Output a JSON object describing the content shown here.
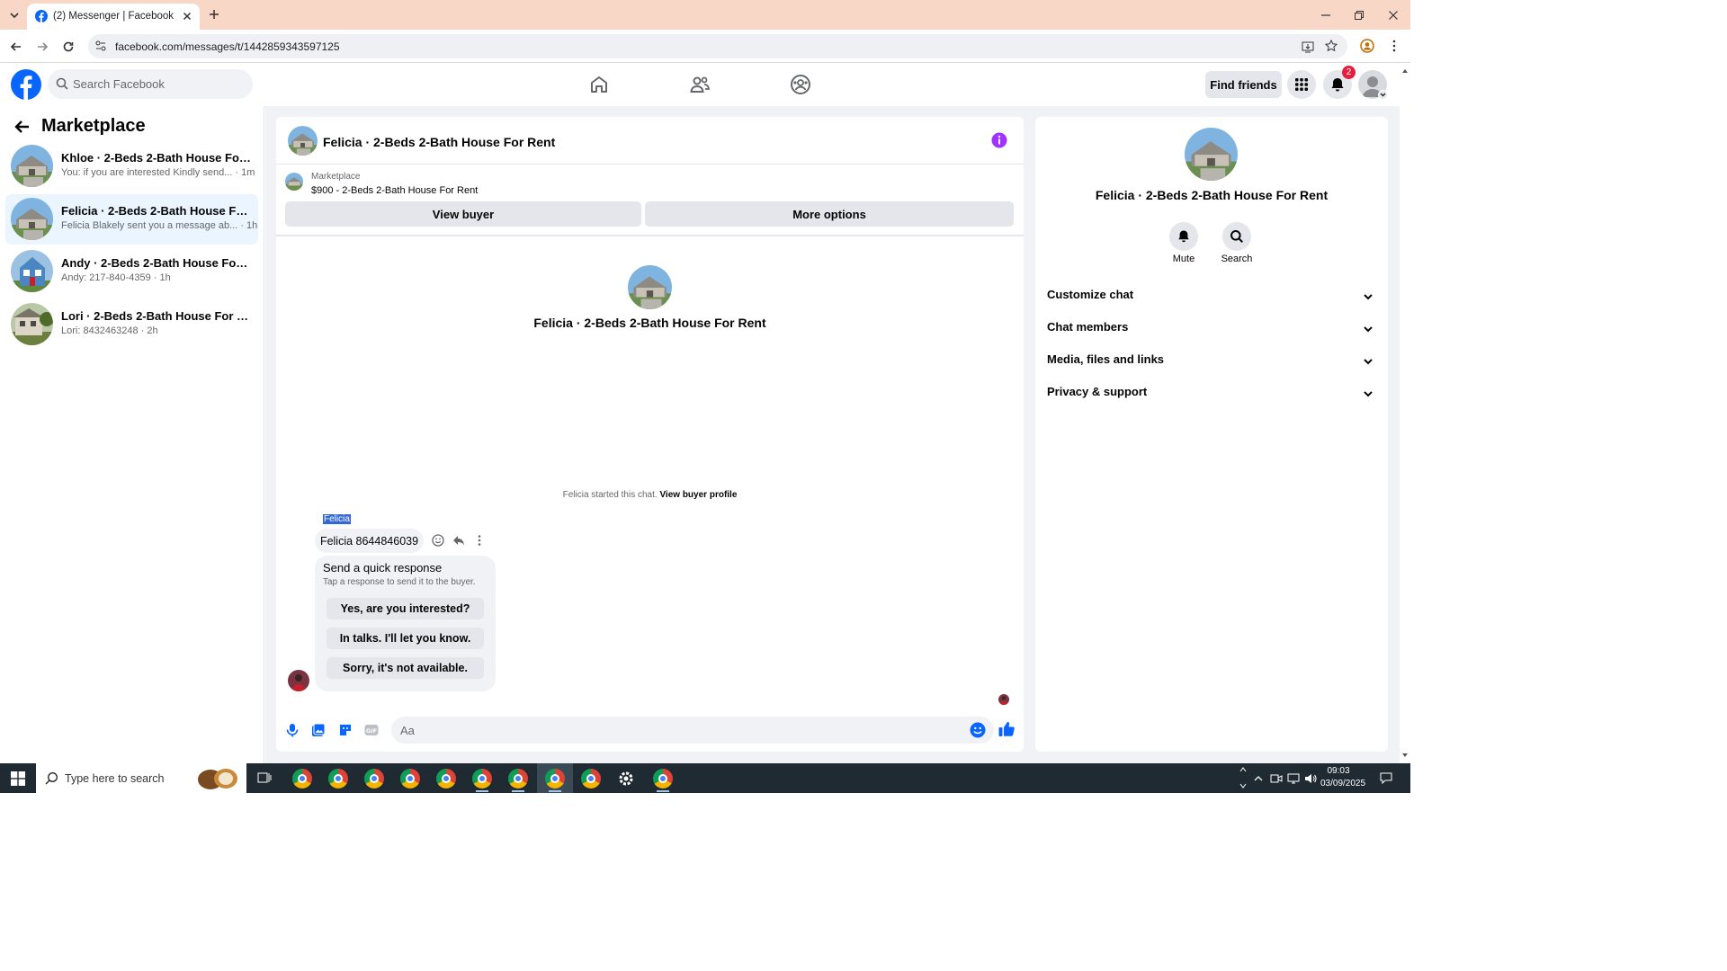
{
  "browser": {
    "tab_title": "(2) Messenger | Facebook",
    "url": "facebook.com/messages/t/1442859343597125"
  },
  "header": {
    "search_placeholder": "Search Facebook",
    "find_friends": "Find friends",
    "notification_count": "2"
  },
  "sidebar": {
    "title": "Marketplace",
    "conversations": [
      {
        "name": "Khloe · 2-Beds 2-Bath House For R...",
        "preview": "You: if you are interested Kindly send... · 1m"
      },
      {
        "name": "Felicia · 2-Beds 2-Bath House For ...",
        "preview": "Felicia Blakely sent you a message ab... · 1h"
      },
      {
        "name": "Andy · 2-Beds 2-Bath House For R...",
        "preview": "Andy: 217-840-4359 · 1h"
      },
      {
        "name": "Lori · 2-Beds 2-Bath House For Rent",
        "preview": "Lori: 8432463248 · 2h"
      }
    ]
  },
  "chat": {
    "title": "Felicia · 2-Beds 2-Bath House For Rent",
    "marketplace_label": "Marketplace",
    "listing": "$900 - 2-Beds 2-Bath House For Rent",
    "view_buyer": "View buyer",
    "more_options": "More options",
    "center_name": "Felicia · 2-Beds 2-Bath House For Rent",
    "started_text": "Felicia started this chat.",
    "view_buyer_profile": "View buyer profile",
    "sender": "Felicia",
    "message": "Felicia 8644846039",
    "quick_title": "Send a quick response",
    "quick_sub": "Tap a response to send it to the buyer.",
    "quick_responses": [
      "Yes, are you interested?",
      "In talks. I'll let you know.",
      "Sorry, it's not available."
    ],
    "composer_placeholder": "Aa"
  },
  "details": {
    "name": "Felicia · 2-Beds 2-Bath House For Rent",
    "mute": "Mute",
    "search": "Search",
    "sections": [
      "Customize chat",
      "Chat members",
      "Media, files and links",
      "Privacy & support"
    ]
  },
  "taskbar": {
    "search_placeholder": "Type here to search",
    "time": "09:03",
    "date": "03/09/2025"
  },
  "colors": {
    "fb_blue": "#0866ff",
    "active_bg": "#ebf5ff",
    "info_purple": "#a033ff"
  }
}
